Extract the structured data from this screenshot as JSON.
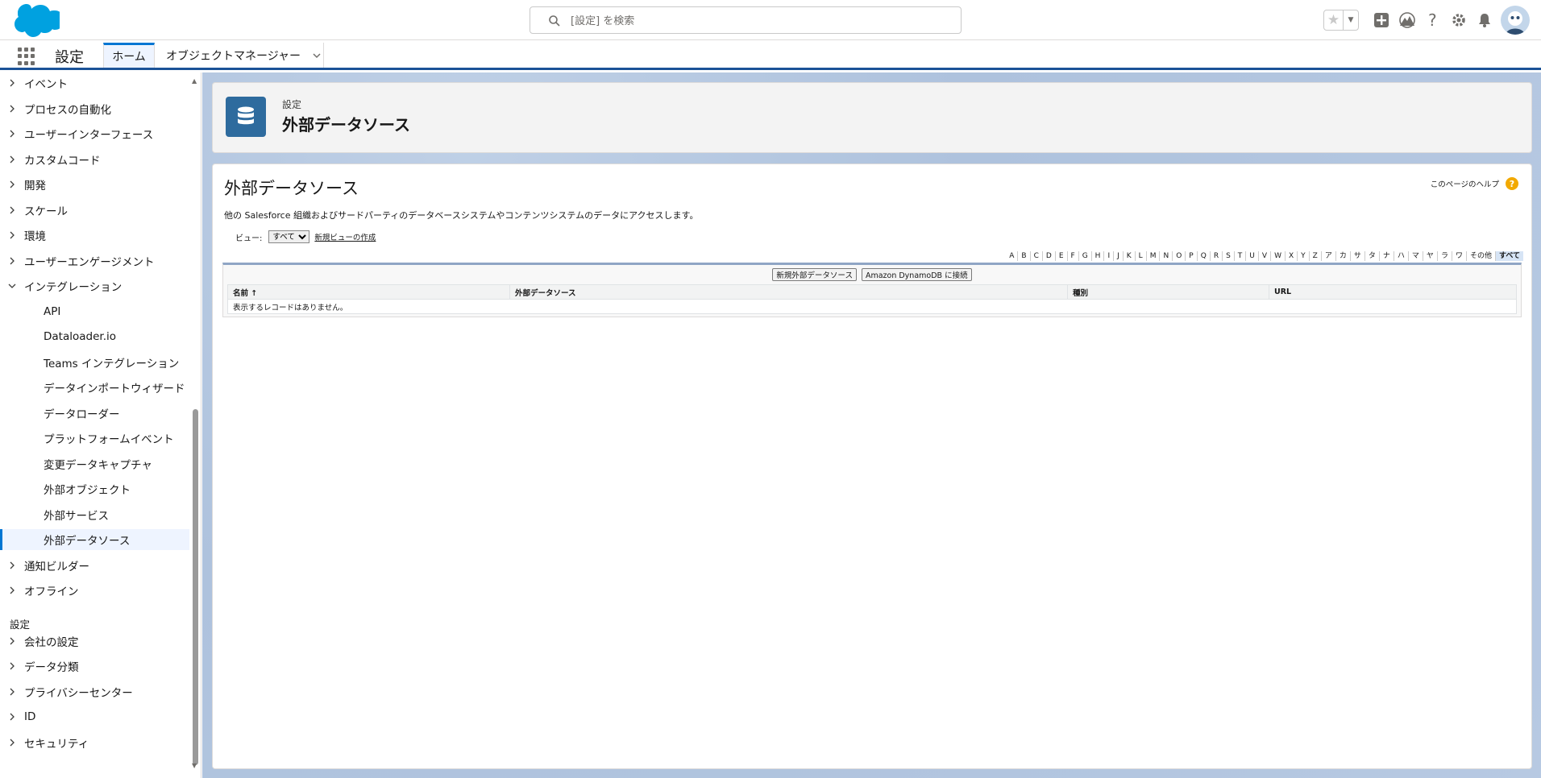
{
  "header": {
    "search_placeholder": "[設定] を検索"
  },
  "nav": {
    "app_name": "設定",
    "tabs": [
      {
        "label": "ホーム"
      },
      {
        "label": "オブジェクトマネージャー"
      }
    ]
  },
  "sidebar": {
    "items": [
      {
        "label": "イベント"
      },
      {
        "label": "プロセスの自動化"
      },
      {
        "label": "ユーザーインターフェース"
      },
      {
        "label": "カスタムコード"
      },
      {
        "label": "開発"
      },
      {
        "label": "スケール"
      },
      {
        "label": "環境"
      },
      {
        "label": "ユーザーエンゲージメント"
      },
      {
        "label": "インテグレーション"
      }
    ],
    "children": [
      {
        "label": "API"
      },
      {
        "label": "Dataloader.io"
      },
      {
        "label": "Teams インテグレーション"
      },
      {
        "label": "データインポートウィザード"
      },
      {
        "label": "データローダー"
      },
      {
        "label": "プラットフォームイベント"
      },
      {
        "label": "変更データキャプチャ"
      },
      {
        "label": "外部オブジェクト"
      },
      {
        "label": "外部サービス"
      },
      {
        "label": "外部データソース"
      }
    ],
    "after": [
      {
        "label": "通知ビルダー"
      },
      {
        "label": "オフライン"
      }
    ],
    "section2_title": "設定",
    "section2": [
      {
        "label": "会社の設定"
      },
      {
        "label": "データ分類"
      },
      {
        "label": "プライバシーセンター"
      },
      {
        "label": "ID"
      },
      {
        "label": "セキュリティ"
      }
    ]
  },
  "page_header": {
    "breadcrumb": "設定",
    "title": "外部データソース"
  },
  "content": {
    "title": "外部データソース",
    "help_link": "このページのヘルプ",
    "description": "他の Salesforce 組織およびサードパーティのデータベースシステムやコンテンツシステムのデータにアクセスします。",
    "view_label": "ビュー:",
    "view_selected": "すべて",
    "new_view_link": "新規ビューの作成",
    "alphabet": [
      "A",
      "B",
      "C",
      "D",
      "E",
      "F",
      "G",
      "H",
      "I",
      "J",
      "K",
      "L",
      "M",
      "N",
      "O",
      "P",
      "Q",
      "R",
      "S",
      "T",
      "U",
      "V",
      "W",
      "X",
      "Y",
      "Z",
      "ア",
      "カ",
      "サ",
      "タ",
      "ナ",
      "ハ",
      "マ",
      "ヤ",
      "ラ",
      "ワ",
      "その他",
      "すべて"
    ],
    "buttons": {
      "new_source": "新規外部データソース",
      "dynamo": "Amazon DynamoDB に接続"
    },
    "table": {
      "headers": [
        "名前 ↑",
        "外部データソース",
        "種別",
        "URL"
      ],
      "empty_message": "表示するレコードはありません。"
    }
  }
}
